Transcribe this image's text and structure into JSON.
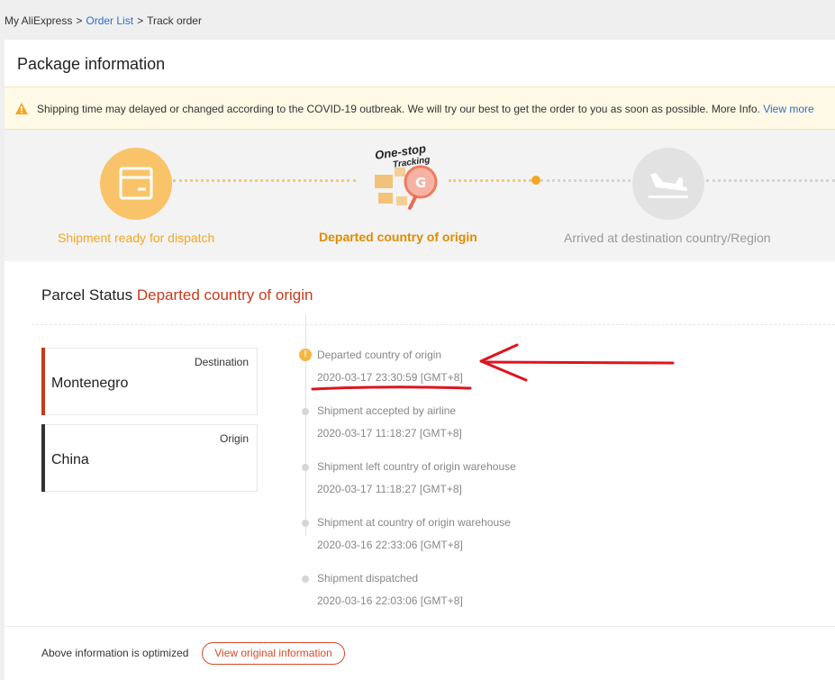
{
  "breadcrumb": {
    "home": "My AliExpress",
    "sep1": ">",
    "order_list": "Order List",
    "sep2": ">",
    "current": "Track order"
  },
  "package": {
    "title": "Package information"
  },
  "notice": {
    "icon": "warning-triangle-icon",
    "text": "Shipping time may delayed or changed according to the COVID-19 outbreak. We will try our best to get the order to you as soon as possible. More Info.",
    "link": "View more"
  },
  "steps": [
    {
      "label": "Shipment ready for dispatch",
      "icon": "package-box-icon",
      "state": "done"
    },
    {
      "label": "Departed country of origin",
      "icon": "one-stop-tracking-logo",
      "state": "current",
      "logo_text_1": "One-stop",
      "logo_text_2": "Tracking"
    },
    {
      "label": "Arrived at destination country/Region",
      "icon": "airplane-landing-icon",
      "state": "pending"
    }
  ],
  "colors": {
    "accent": "#f5a623",
    "step_done_label": "#f5a623",
    "step_current_label": "#e08b00",
    "step_pending_label": "#999999",
    "status_red": "#c73a1c",
    "annotation_red": "#e0141e",
    "destination_bar": "#c73a1c",
    "origin_bar": "#333333"
  },
  "parcel_status": {
    "label": "Parcel Status",
    "value": "Departed country of origin"
  },
  "locations": {
    "destination": {
      "type": "Destination",
      "place": "Montenegro"
    },
    "origin": {
      "type": "Origin",
      "place": "China"
    }
  },
  "timeline": [
    {
      "event": "Departed country of origin",
      "time": "2020-03-17 23:30:59 [GMT+8]"
    },
    {
      "event": "Shipment accepted by airline",
      "time": "2020-03-17 11:18:27 [GMT+8]"
    },
    {
      "event": "Shipment left country of origin warehouse",
      "time": "2020-03-17 11:18:27 [GMT+8]"
    },
    {
      "event": "Shipment at country of origin warehouse",
      "time": "2020-03-16 22:33:06 [GMT+8]"
    },
    {
      "event": "Shipment dispatched",
      "time": "2020-03-16 22:03:06 [GMT+8]"
    }
  ],
  "footer": {
    "text": "Above information is optimized",
    "button": "View original information"
  }
}
